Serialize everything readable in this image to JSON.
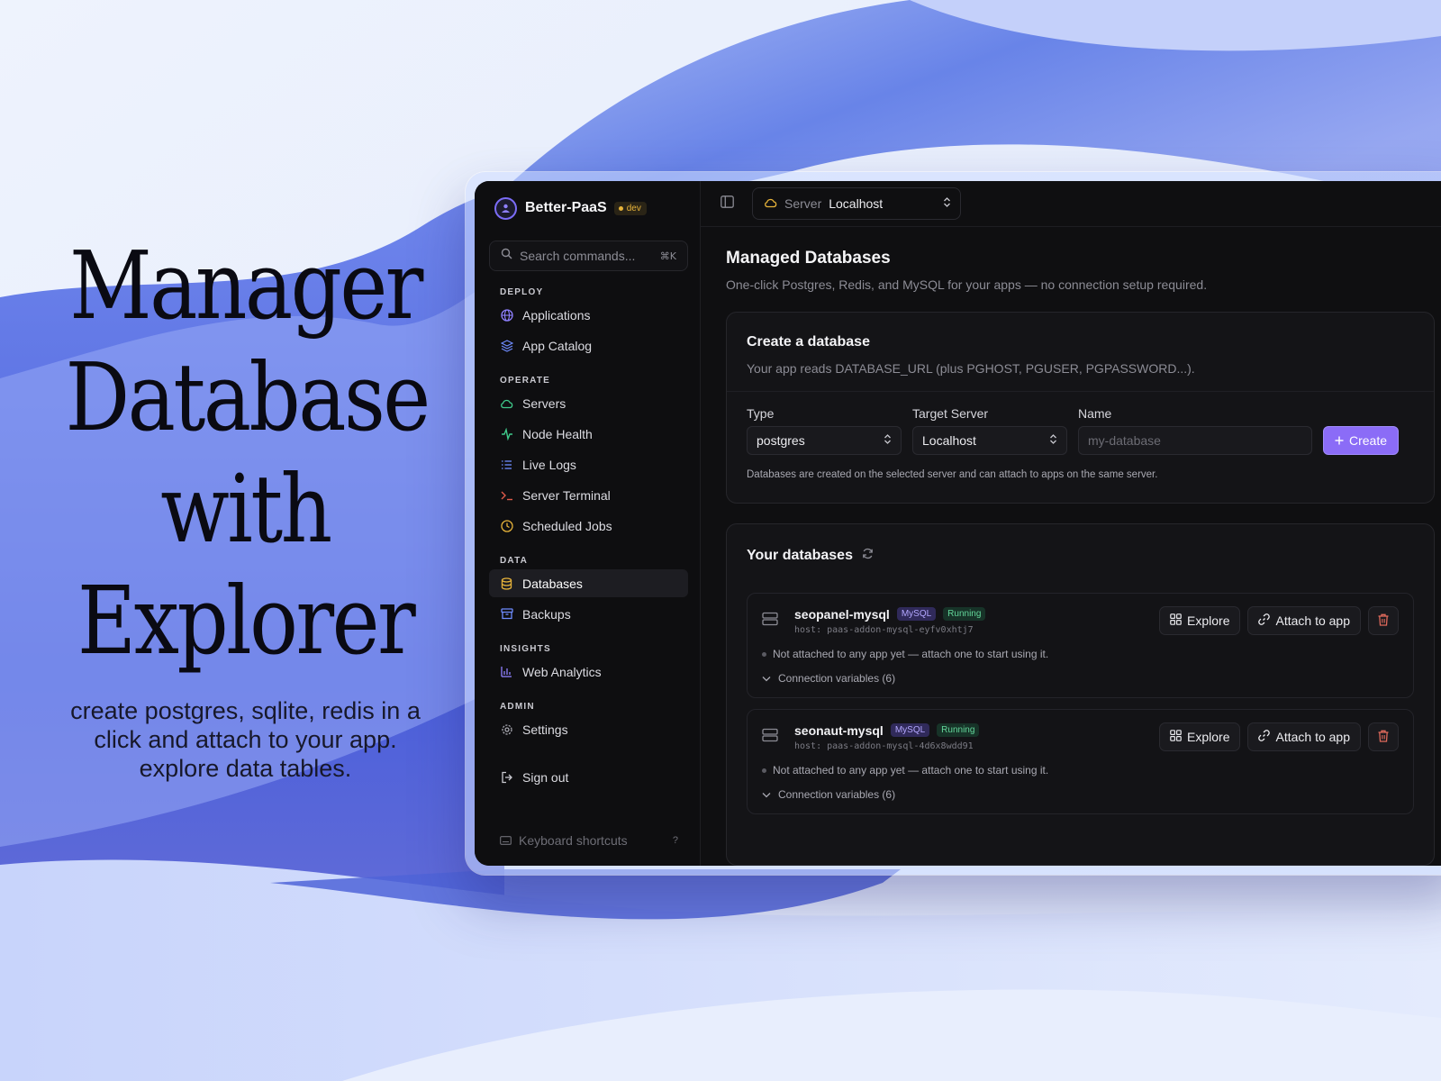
{
  "hero": {
    "title_lines": [
      "Manager",
      "Database",
      "with",
      "Explorer"
    ],
    "subtitle": "create postgres, sqlite, redis in a click and attach to your app. explore data tables."
  },
  "brand": {
    "name": "Better-PaaS",
    "badge": "dev"
  },
  "search": {
    "placeholder": "Search commands...",
    "shortcut": "⌘K"
  },
  "sidebar": {
    "sections": [
      {
        "label": "DEPLOY",
        "items": [
          {
            "label": "Applications",
            "icon": "globe-icon"
          },
          {
            "label": "App Catalog",
            "icon": "layers-icon"
          }
        ]
      },
      {
        "label": "OPERATE",
        "items": [
          {
            "label": "Servers",
            "icon": "cloud-icon"
          },
          {
            "label": "Node Health",
            "icon": "activity-icon"
          },
          {
            "label": "Live Logs",
            "icon": "list-icon"
          },
          {
            "label": "Server Terminal",
            "icon": "terminal-icon"
          },
          {
            "label": "Scheduled Jobs",
            "icon": "clock-icon"
          }
        ]
      },
      {
        "label": "DATA",
        "items": [
          {
            "label": "Databases",
            "icon": "database-icon",
            "active": true
          },
          {
            "label": "Backups",
            "icon": "archive-icon"
          }
        ]
      },
      {
        "label": "INSIGHTS",
        "items": [
          {
            "label": "Web Analytics",
            "icon": "bar-chart-icon"
          }
        ]
      },
      {
        "label": "ADMIN",
        "items": [
          {
            "label": "Settings",
            "icon": "gear-icon"
          }
        ]
      }
    ],
    "signout": "Sign out",
    "shortcuts": "Keyboard shortcuts",
    "shortcuts_key": "?"
  },
  "topbar": {
    "server_label": "Server",
    "server_value": "Localhost"
  },
  "page": {
    "title": "Managed Databases",
    "subtitle": "One-click Postgres, Redis, and MySQL for your apps — no connection setup required."
  },
  "create": {
    "title": "Create a database",
    "desc": "Your app reads DATABASE_URL (plus PGHOST, PGUSER, PGPASSWORD...).",
    "type_label": "Type",
    "type_value": "postgres",
    "target_label": "Target Server",
    "target_value": "Localhost",
    "name_label": "Name",
    "name_placeholder": "my-database",
    "button": "Create",
    "note": "Databases are created on the selected server and can attach to apps on the same server."
  },
  "databases": {
    "title": "Your databases",
    "items": [
      {
        "name": "seopanel-mysql",
        "engine": "MySQL",
        "status": "Running",
        "host": "host: paas-addon-mysql-eyfv0xhtj7",
        "note": "Not attached to any app yet — attach one to start using it.",
        "conn": "Connection variables (6)",
        "explore": "Explore",
        "attach": "Attach to app"
      },
      {
        "name": "seonaut-mysql",
        "engine": "MySQL",
        "status": "Running",
        "host": "host: paas-addon-mysql-4d6x8wdd91",
        "note": "Not attached to any app yet — attach one to start using it.",
        "conn": "Connection variables (6)",
        "explore": "Explore",
        "attach": "Attach to app"
      }
    ]
  },
  "colors": {
    "accent": "#8b6cf7",
    "running": "#63d69a",
    "dev_badge": "#e7b33a",
    "delete": "#e06a5c"
  }
}
